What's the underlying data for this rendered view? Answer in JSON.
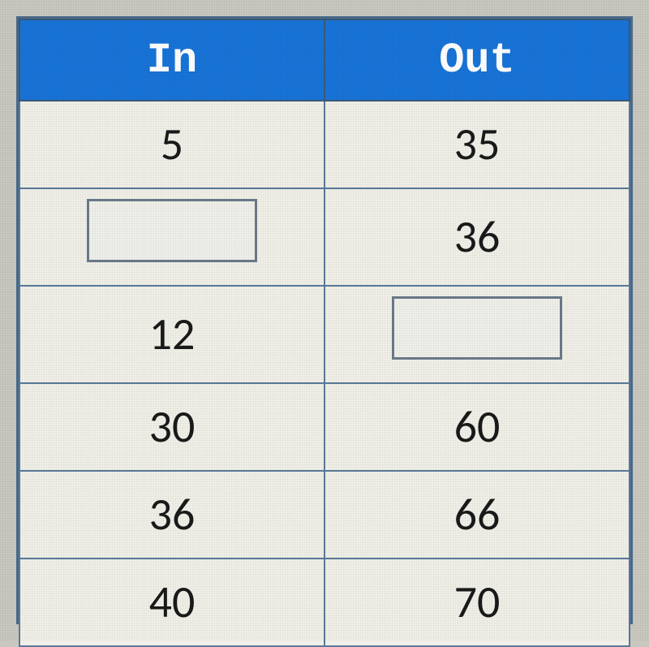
{
  "chart_data": {
    "type": "table",
    "title": "",
    "columns": [
      "In",
      "Out"
    ],
    "rows": [
      {
        "in": "5",
        "out": "35",
        "in_blank": false,
        "out_blank": false
      },
      {
        "in": "",
        "out": "36",
        "in_blank": true,
        "out_blank": false
      },
      {
        "in": "12",
        "out": "",
        "in_blank": false,
        "out_blank": true
      },
      {
        "in": "30",
        "out": "60",
        "in_blank": false,
        "out_blank": false
      },
      {
        "in": "36",
        "out": "66",
        "in_blank": false,
        "out_blank": false
      },
      {
        "in": "40",
        "out": "70",
        "in_blank": false,
        "out_blank": false
      }
    ]
  }
}
